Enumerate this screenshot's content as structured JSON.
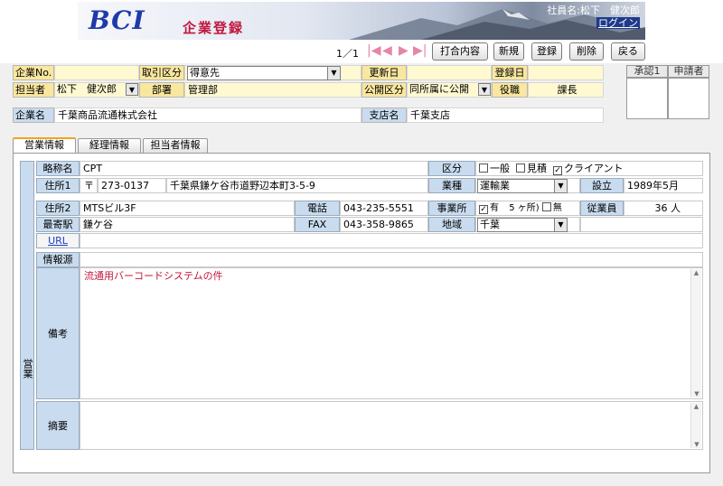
{
  "header": {
    "logo": "BCI",
    "title": "企業登録",
    "user_label": "社員名:松下　健次郎",
    "login_link": "ログイン"
  },
  "pager": {
    "text": "1／1"
  },
  "toolbar": {
    "meeting": "打合内容",
    "new": "新規",
    "register": "登録",
    "delete": "削除",
    "back": "戻る"
  },
  "top_form": {
    "company_no_label": "企業No.",
    "company_no_value": "",
    "trade_type_label": "取引区分",
    "trade_type_value": "得意先",
    "updated_label": "更新日",
    "updated_value": "",
    "registered_label": "登録日",
    "registered_value": "",
    "owner_label": "担当者",
    "owner_value": "松下　健次郎",
    "dept_label": "部署",
    "dept_value": "管理部",
    "public_label": "公開区分",
    "public_value": "同所属に公開",
    "position_label": "役職",
    "position_value": "課長",
    "company_name_label": "企業名",
    "company_name_value": "千葉商品流通株式会社",
    "branch_label": "支店名",
    "branch_value": "千葉支店"
  },
  "approval": {
    "col1": "承認1",
    "col2": "申請者"
  },
  "tabs": [
    {
      "label": "営業情報"
    },
    {
      "label": "経理情報"
    },
    {
      "label": "担当者情報"
    }
  ],
  "sales": {
    "side_label": "営業",
    "abbr_label": "略称名",
    "abbr_value": "CPT",
    "category_label": "区分",
    "cat_general": "一般",
    "cat_estimate": "見積",
    "cat_client": "クライアント",
    "addr1_label": "住所1",
    "postal_mark": "〒",
    "postal_value": "273-0137",
    "addr1_value": "千葉県鎌ケ谷市道野辺本町3-5-9",
    "industry_label": "業種",
    "industry_value": "運輸業",
    "founded_label": "設立",
    "founded_value": "1989年5月",
    "addr2_label": "住所2",
    "addr2_value": "MTSビル3F",
    "tel_label": "電話",
    "tel_value": "043-235-5551",
    "office_label": "事業所",
    "office_yes": "有",
    "office_count": "5 ヶ所)",
    "office_no": "無",
    "employees_label": "従業員",
    "employees_value": "36 人",
    "station_label": "最寄駅",
    "station_value": "鎌ケ谷",
    "fax_label": "FAX",
    "fax_value": "043-358-9865",
    "region_label": "地域",
    "region_value": "千葉",
    "url_label": "URL",
    "url_value": "",
    "source_label": "情報源",
    "source_value": "",
    "remarks_label": "備考",
    "remarks_value": "流通用バーコードシステムの件",
    "summary_label": "摘要",
    "summary_value": ""
  },
  "colors": {
    "label_yellow": "#f9e79f",
    "label_blue": "#c9dcef",
    "title_red": "#c0163d",
    "logo_blue": "#1f3aa8"
  }
}
